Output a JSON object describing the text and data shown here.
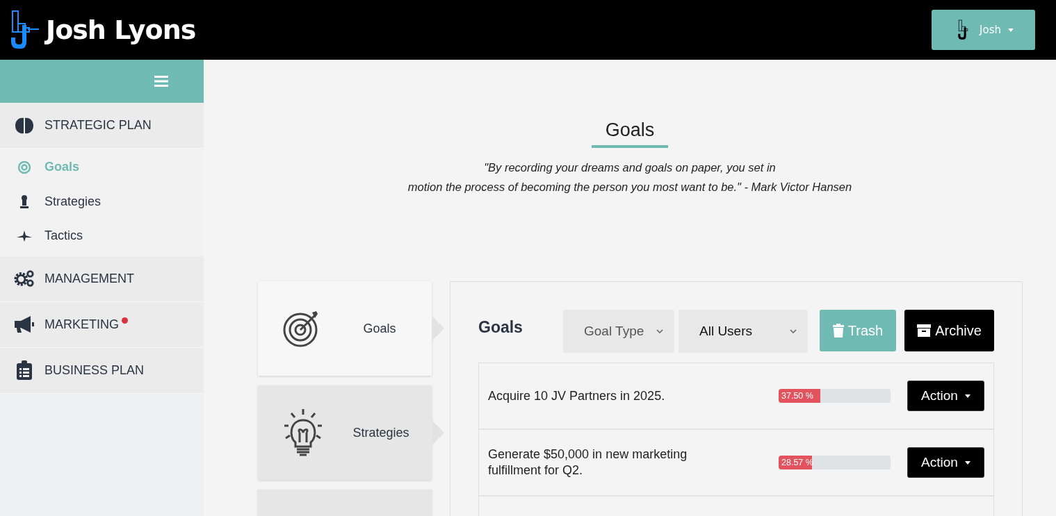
{
  "header": {
    "brand": "Josh Lyons",
    "user_button": "Josh"
  },
  "sidebar": {
    "sections": [
      {
        "label": "STRATEGIC PLAN",
        "notification": false,
        "expanded": true,
        "children": [
          {
            "label": "Goals",
            "selected": true
          },
          {
            "label": "Strategies",
            "selected": false
          },
          {
            "label": "Tactics",
            "selected": false
          }
        ]
      },
      {
        "label": "MANAGEMENT",
        "notification": false,
        "expanded": false
      },
      {
        "label": "MARKETING",
        "notification": true,
        "expanded": false
      },
      {
        "label": "BUSINESS PLAN",
        "notification": false,
        "expanded": false
      }
    ]
  },
  "page": {
    "title": "Goals",
    "quote_lines": [
      "\"By recording your dreams and goals on paper, you set in",
      "motion the process of becoming the person you most want to be.\" - Mark Victor Hansen"
    ]
  },
  "steps": [
    {
      "label": "Goals",
      "selected": true
    },
    {
      "label": "Strategies",
      "selected": false
    },
    {
      "selected": false
    }
  ],
  "panel": {
    "title": "Goals",
    "filters": [
      {
        "value": "Goal Type",
        "placeholder": true
      },
      {
        "value": "All Users",
        "placeholder": false
      }
    ],
    "buttons": [
      {
        "label": "Trash",
        "kind": "trash"
      },
      {
        "label": "Archive",
        "kind": "archive"
      }
    ],
    "goals": [
      {
        "text": "Acquire 10 JV Partners in 2025.",
        "level": 0.375,
        "reading": "37.50 %",
        "action": "Action"
      },
      {
        "text": "Generate $50,000 in new marketing fulfillment for Q2.",
        "level": 0.3,
        "reading": "28.57 %",
        "action": "Action"
      }
    ]
  }
}
